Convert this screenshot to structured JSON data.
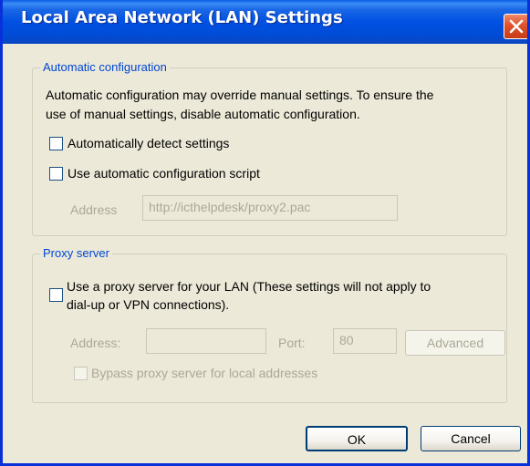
{
  "window": {
    "title": "Local Area Network (LAN) Settings"
  },
  "auto_config": {
    "legend": "Automatic configuration",
    "description_line1": "Automatic configuration may override manual settings.  To ensure the",
    "description_line2": "use of manual settings, disable automatic configuration.",
    "detect_label": "Automatically detect settings",
    "detect_checked": false,
    "script_label": "Use automatic configuration script",
    "script_checked": false,
    "address_label": "Address",
    "address_value": "http://icthelpdesk/proxy2.pac"
  },
  "proxy": {
    "legend": "Proxy server",
    "use_proxy_line1": "Use a proxy server for your LAN (These settings will not apply to",
    "use_proxy_line2": "dial-up or VPN connections).",
    "use_proxy_checked": false,
    "address_label": "Address:",
    "address_value": "",
    "port_label": "Port:",
    "port_value": "80",
    "advanced_label": "Advanced",
    "bypass_label": "Bypass proxy server for local addresses",
    "bypass_checked": false
  },
  "buttons": {
    "ok": "OK",
    "cancel": "Cancel"
  },
  "icons": {
    "close": "close-icon"
  },
  "colors": {
    "titlebar": "#0050e2",
    "close_button": "#e0522c",
    "group_legend": "#0046d5",
    "dialog_background": "#ece9d8",
    "disabled_text": "#aca899"
  }
}
